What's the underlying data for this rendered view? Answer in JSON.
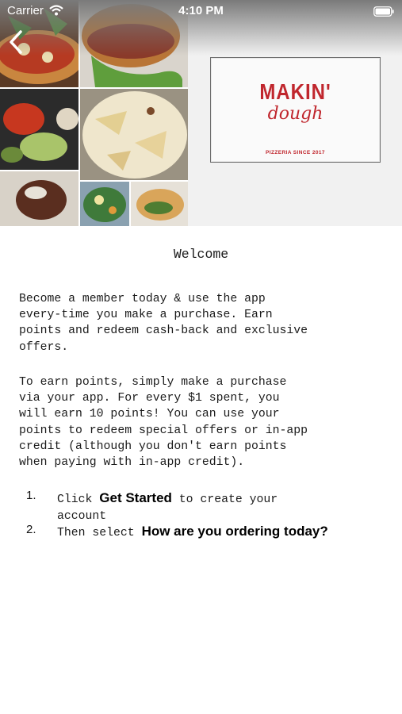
{
  "status_bar": {
    "carrier": "Carrier",
    "time": "4:10 PM",
    "icons": [
      "wifi-icon",
      "battery-icon"
    ]
  },
  "header": {
    "back_icon": "chevron-left-icon",
    "logo": {
      "title": "MAKIN'",
      "script": "dough",
      "subtitle": "PIZZERIA SINCE 2017"
    }
  },
  "content": {
    "title": "Welcome",
    "paragraph1": "Become a member today & use the app\nevery-time you make a purchase. Earn\npoints and redeem cash-back and exclusive\noffers.",
    "paragraph2": "To earn points, simply make a purchase\nvia your app. For every $1 spent, you\nwill earn 10 points! You can use your\npoints to redeem special offers or in-app\ncredit (although you don't earn points\nwhen paying with in-app credit).",
    "steps": [
      {
        "number": "1.",
        "prefix": "Click ",
        "bold": "Get Started",
        "suffix": " to create your\naccount"
      },
      {
        "number": "2.",
        "prefix": "Then select ",
        "bold": "How are you ordering today?",
        "suffix": ""
      }
    ]
  },
  "colors": {
    "brand_red": "#c0262d",
    "text": "#1a1a1a",
    "background": "#ffffff"
  }
}
